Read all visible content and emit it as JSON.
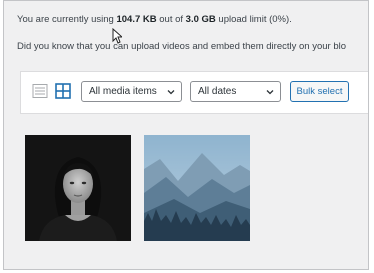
{
  "notices": {
    "usage_prefix": "You are currently using ",
    "usage_amount": "104.7 KB",
    "usage_middle": " out of ",
    "usage_limit": "3.0 GB",
    "usage_suffix": " upload limit (0%).",
    "tip": "Did you know that you can upload videos and embed them directly on your blo"
  },
  "toolbar": {
    "media_filter": {
      "selected": "All media items"
    },
    "date_filter": {
      "selected": "All dates"
    },
    "bulk_select_label": "Bulk select",
    "active_view": "grid"
  },
  "media_items": [
    {
      "name": "portrait-photo",
      "kind": "image"
    },
    {
      "name": "mountain-forest-photo",
      "kind": "image"
    }
  ],
  "colors": {
    "accent": "#2271b1",
    "background": "#f0f0f1",
    "panel": "#ffffff",
    "text": "#3c434a"
  }
}
